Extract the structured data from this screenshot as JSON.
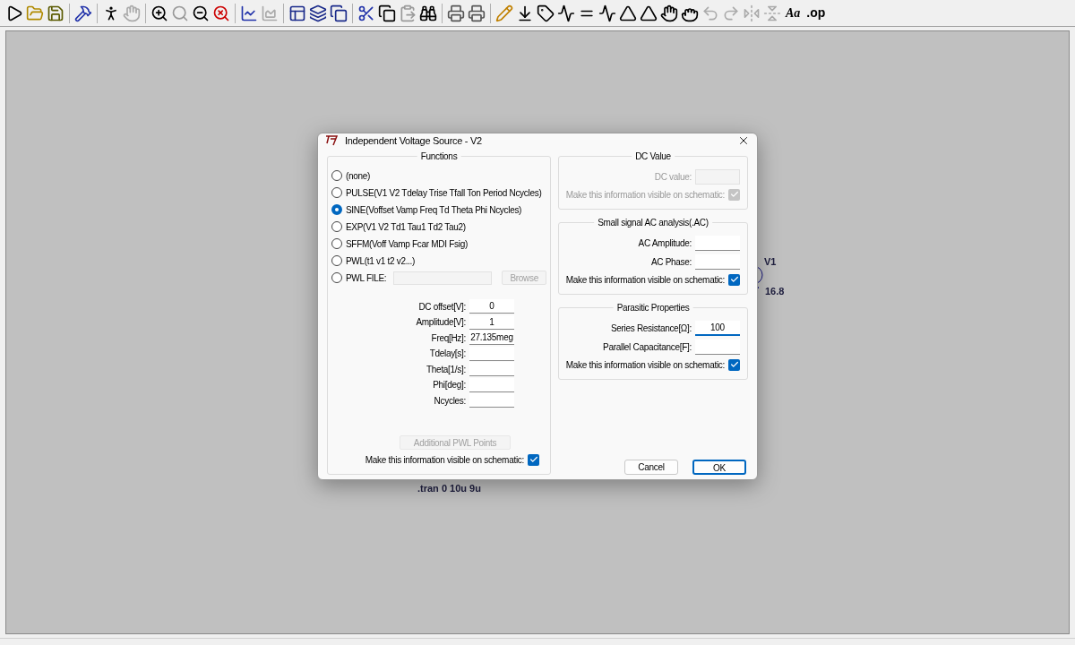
{
  "toolbar": {
    "text_tools": [
      "Aa",
      ".op"
    ]
  },
  "schematic": {
    "component_name": "V1",
    "component_value": "16.8",
    "directive": ".tran 0 10u 9u"
  },
  "dialog": {
    "title": "Independent Voltage Source - V2",
    "functions": {
      "title": "Functions",
      "options": [
        {
          "label": "(none)",
          "selected": false
        },
        {
          "label": "PULSE(V1 V2 Tdelay Trise Tfall Ton Period Ncycles)",
          "selected": false
        },
        {
          "label": "SINE(Voffset Vamp Freq Td Theta Phi Ncycles)",
          "selected": true
        },
        {
          "label": "EXP(V1 V2 Td1 Tau1 Td2 Tau2)",
          "selected": false
        },
        {
          "label": "SFFM(Voff Vamp Fcar MDI Fsig)",
          "selected": false
        },
        {
          "label": "PWL(t1 v1 t2 v2...)",
          "selected": false
        },
        {
          "label": "PWL FILE:",
          "selected": false
        }
      ],
      "browse": {
        "label": "Browse",
        "disabled": true
      },
      "params": [
        {
          "label": "DC offset[V]:",
          "value": "0"
        },
        {
          "label": "Amplitude[V]:",
          "value": "1"
        },
        {
          "label": "Freq[Hz]:",
          "value": "27.135meg"
        },
        {
          "label": "Tdelay[s]:"
        },
        {
          "label": "Theta[1/s]:"
        },
        {
          "label": "Phi[deg]:"
        },
        {
          "label": "Ncycles:"
        }
      ],
      "pwl_points": {
        "label": "Additional PWL Points",
        "disabled": true
      },
      "visible": {
        "label": "Make this information visible on schematic:",
        "checked": true,
        "disabled": false
      }
    },
    "dc_value": {
      "title": "DC Value",
      "fields": [
        {
          "label": "DC value:",
          "disabled": true,
          "focused": false
        }
      ],
      "visible": {
        "label": "Make this information visible on schematic:",
        "checked": true,
        "disabled": true
      }
    },
    "ac_analysis": {
      "title": "Small signal AC analysis(.AC)",
      "fields": [
        {
          "label": "AC Amplitude:",
          "disabled": false,
          "focused": false
        },
        {
          "label": "AC Phase:",
          "disabled": false,
          "focused": false
        }
      ],
      "visible": {
        "label": "Make this information visible on schematic:",
        "checked": true,
        "disabled": false
      }
    },
    "parasitic": {
      "title": "Parasitic Properties",
      "fields": [
        {
          "label": "Series Resistance[Ω]:",
          "value": "100",
          "focused": true,
          "disabled": false
        },
        {
          "label": "Parallel Capacitance[F]:",
          "disabled": false,
          "focused": false
        }
      ],
      "visible": {
        "label": "Make this information visible on schematic:",
        "checked": true,
        "disabled": false
      }
    },
    "buttons": [
      {
        "label": "Cancel",
        "default": false
      },
      {
        "label": "OK",
        "default": true
      }
    ]
  }
}
